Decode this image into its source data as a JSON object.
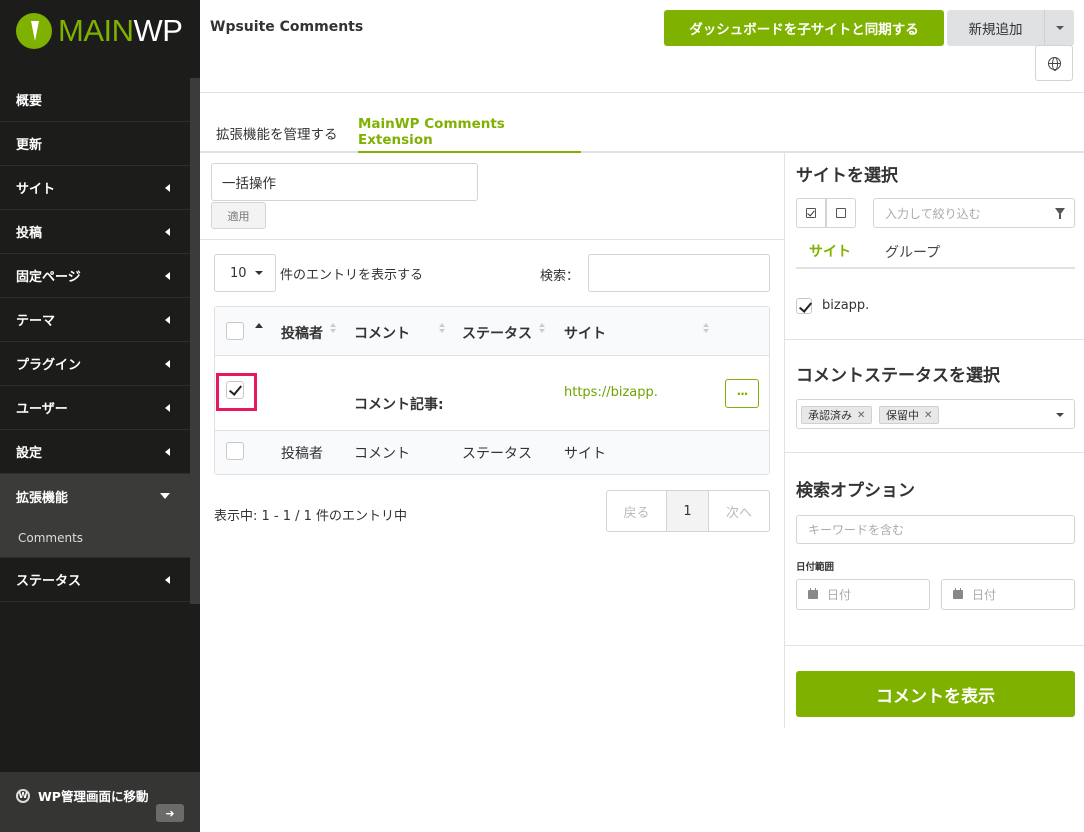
{
  "brand": {
    "prefix": "MAIN",
    "suffix": "WP",
    "accent": "#7fb100"
  },
  "sidebar": {
    "items": [
      {
        "label": "概要"
      },
      {
        "label": "更新"
      },
      {
        "label": "サイト"
      },
      {
        "label": "投稿"
      },
      {
        "label": "固定ページ"
      },
      {
        "label": "テーマ"
      },
      {
        "label": "プラグイン"
      },
      {
        "label": "ユーザー"
      },
      {
        "label": "設定"
      },
      {
        "label": "拡張機能"
      },
      {
        "label": "ステータス"
      }
    ],
    "active_sub": "Comments",
    "footer_label": "WP管理画面に移動"
  },
  "header": {
    "title": "Wpsuite Comments",
    "sync_button": "ダッシュボードを子サイトと同期する",
    "add_new": "新規追加"
  },
  "tabs": {
    "manage": "拡張機能を管理する",
    "comments": "MainWP Comments Extension"
  },
  "bulk": {
    "selected": "一括操作",
    "apply": "適用"
  },
  "entries": {
    "value": "10",
    "label": "件のエントリを表示する",
    "search_label": "検索："
  },
  "table": {
    "headers": [
      "投稿者",
      "コメント",
      "ステータス",
      "サイト"
    ],
    "row": {
      "comment": "コメント記事:",
      "site": "https://bizapp.",
      "menu": "···"
    },
    "footers": [
      "投稿者",
      "コメント",
      "ステータス",
      "サイト"
    ]
  },
  "info": "表示中: 1 - 1 / 1 件のエントリ中",
  "pager": {
    "prev": "戻る",
    "current": "1",
    "next": "次へ"
  },
  "right": {
    "site_heading": "サイトを選択",
    "filter_placeholder": "入力して絞り込む",
    "tab_site": "サイト",
    "tab_group": "グループ",
    "site_item": "bizapp.",
    "status_heading": "コメントステータスを選択",
    "status_chips": [
      "承認済み",
      "保留中"
    ],
    "search_heading": "検索オプション",
    "keyword_placeholder": "キーワードを含む",
    "date_label": "日付範囲",
    "date_from": "日付",
    "date_to": "日付",
    "show_button": "コメントを表示"
  }
}
